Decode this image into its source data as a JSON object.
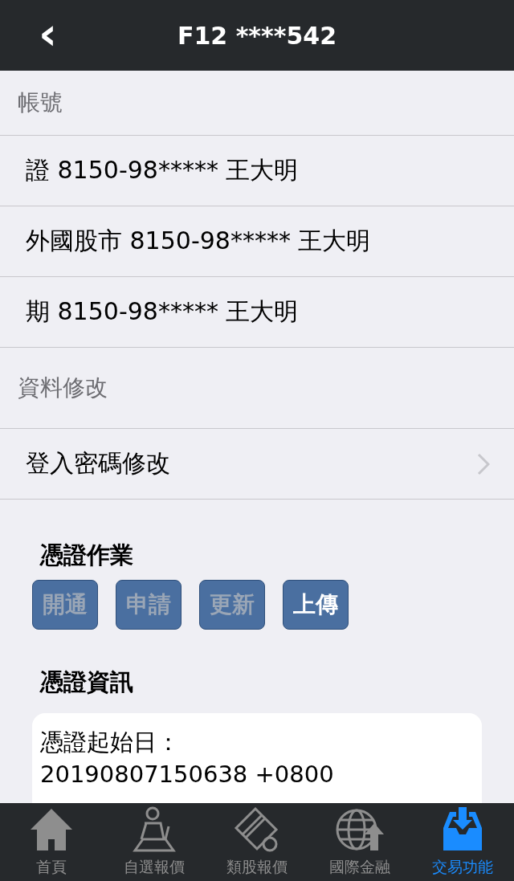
{
  "header": {
    "back": "‹",
    "title": "F12 ****542"
  },
  "sections": [
    {
      "title": "帳號",
      "rows": [
        {
          "label": "證 8150-98***** 王大明",
          "chevron": false
        },
        {
          "label": "外國股市 8150-98***** 王大明",
          "chevron": false
        },
        {
          "label": "期 8150-98***** 王大明",
          "chevron": false
        }
      ]
    },
    {
      "title": "資料修改",
      "rows": [
        {
          "label": "登入密碼修改",
          "chevron": true
        }
      ]
    }
  ],
  "cert_ops": {
    "title": "憑證作業",
    "buttons": [
      {
        "label": "開通",
        "disabled": true
      },
      {
        "label": "申請",
        "disabled": true
      },
      {
        "label": "更新",
        "disabled": true
      },
      {
        "label": "上傳",
        "disabled": false
      }
    ]
  },
  "cert_info": {
    "title": "憑證資訊",
    "lines": [
      "憑證起始日：",
      "20190807150638 +0800"
    ]
  },
  "tab_bar": [
    {
      "label": "首頁",
      "kind": "home",
      "selected": false
    },
    {
      "label": "自選報價",
      "kind": "person",
      "selected": false
    },
    {
      "label": "類股報價",
      "kind": "film",
      "selected": false
    },
    {
      "label": "國際金融",
      "kind": "globe",
      "selected": false
    },
    {
      "label": "交易功能",
      "kind": "tray",
      "selected": true
    }
  ]
}
